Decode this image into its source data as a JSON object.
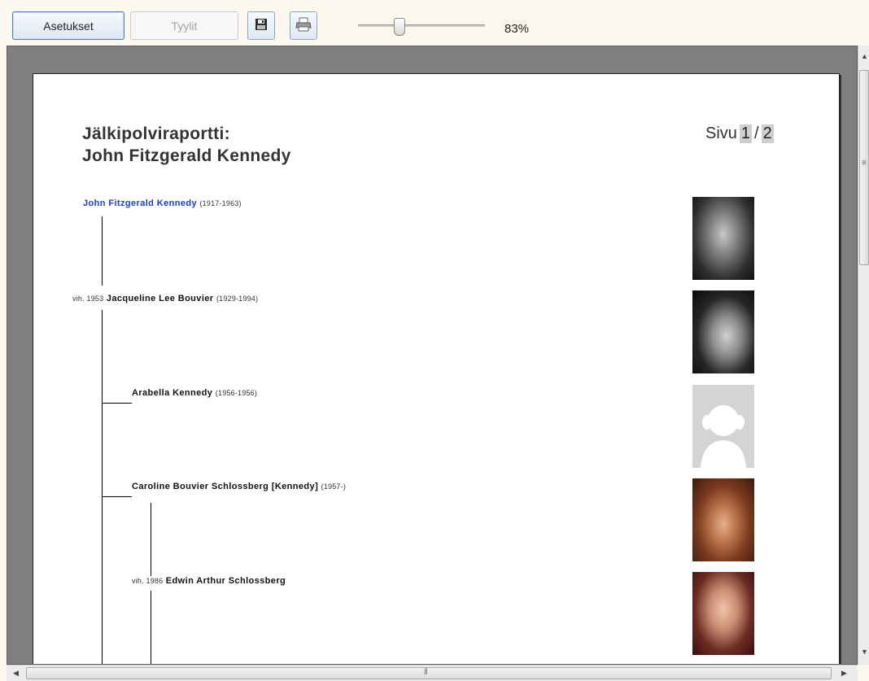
{
  "toolbar": {
    "settings_label": "Asetukset",
    "styles_label": "Tyylit",
    "save_icon": "save-icon",
    "print_icon": "print-icon",
    "zoom": "83%"
  },
  "report": {
    "title_line1": "Jälkipolviraportti:",
    "title_line2": "John Fitzgerald Kennedy",
    "page_prefix": "Sivu",
    "page_current": "1",
    "page_sep": "/",
    "page_total": "2"
  },
  "entries": [
    {
      "name": "John Fitzgerald Kennedy",
      "years": "(1917-1963)"
    },
    {
      "marriage": "vih. 1953",
      "name": "Jacqueline Lee Bouvier",
      "years": "(1929-1994)"
    },
    {
      "name": "Arabella Kennedy",
      "years": "(1956-1956)"
    },
    {
      "name": "Caroline Bouvier Schlossberg [Kennedy]",
      "years": "(1957-)"
    },
    {
      "marriage": "vih. 1986",
      "name": "Edwin Arthur Schlossberg",
      "years": ""
    }
  ]
}
